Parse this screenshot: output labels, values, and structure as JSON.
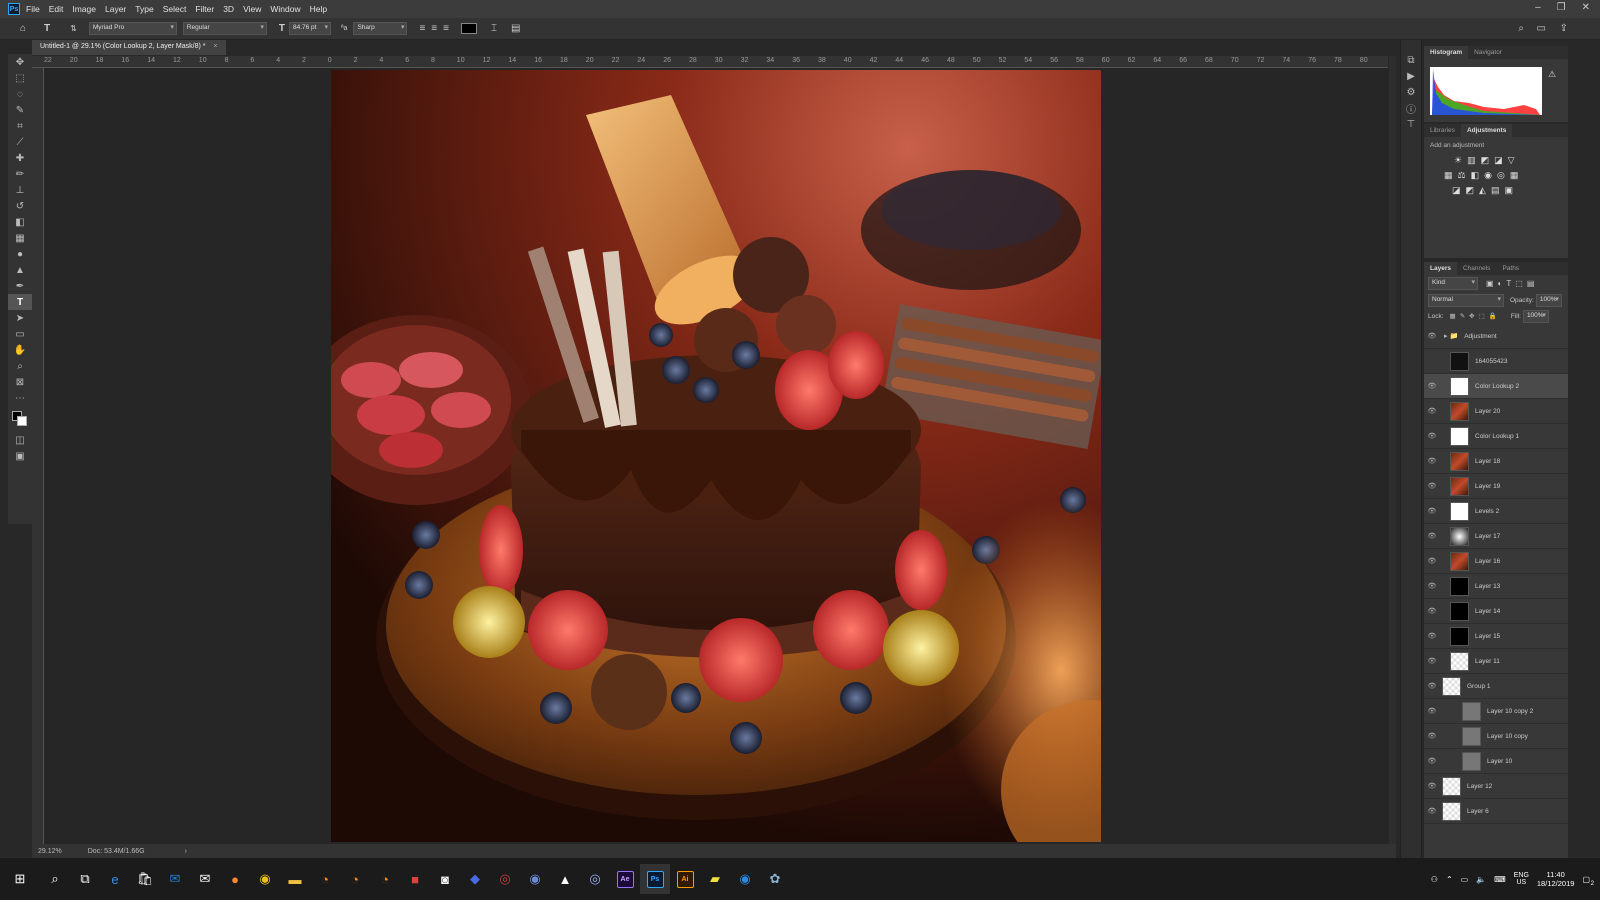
{
  "app": {
    "logo": "Ps"
  },
  "menu": [
    "File",
    "Edit",
    "Image",
    "Layer",
    "Type",
    "Select",
    "Filter",
    "3D",
    "View",
    "Window",
    "Help"
  ],
  "options": {
    "font_family": "Myriad Pro",
    "font_style": "Regular",
    "font_size": "84.76 pt",
    "antialias": "Sharp",
    "text_color": "#000000"
  },
  "document": {
    "tab_title": "Untitled-1 @ 29.1% (Color Lookup 2, Layer Mask/8) *",
    "zoom": "29.12%",
    "doc_info": "Doc: 53.4M/1.66G"
  },
  "ruler": {
    "top_ticks": [
      "22",
      "20",
      "18",
      "16",
      "14",
      "12",
      "10",
      "8",
      "6",
      "4",
      "2",
      "0",
      "2",
      "4",
      "6",
      "8",
      "10",
      "12",
      "14",
      "16",
      "18",
      "20",
      "22",
      "24",
      "26",
      "28",
      "30",
      "32",
      "34",
      "36",
      "38",
      "40",
      "42",
      "44",
      "46",
      "48",
      "50",
      "52",
      "54",
      "56",
      "58",
      "60",
      "62",
      "64",
      "66",
      "68",
      "70",
      "72",
      "74",
      "76",
      "78",
      "80"
    ]
  },
  "panels": {
    "histogram_tabs": [
      "Histogram",
      "Navigator"
    ],
    "adjust_tabs": [
      "Libraries",
      "Adjustments"
    ],
    "adjust_hint": "Add an adjustment",
    "layers_tabs": [
      "Layers",
      "Channels",
      "Paths"
    ],
    "filter_kind": "Kind",
    "blend_mode": "Normal",
    "opacity_label": "Opacity:",
    "opacity_value": "100%",
    "lock_label": "Lock:",
    "fill_label": "Fill:",
    "fill_value": "100%"
  },
  "layers": [
    {
      "name": "Adjustment",
      "thumb": "folder",
      "visible": true
    },
    {
      "name": "164055423",
      "thumb": "dark",
      "visible": false
    },
    {
      "name": "Color Lookup 2",
      "thumb": "white",
      "visible": true,
      "selected": true
    },
    {
      "name": "Layer 20",
      "thumb": "photo",
      "visible": true
    },
    {
      "name": "Color Lookup 1",
      "thumb": "white",
      "visible": true
    },
    {
      "name": "Layer 18",
      "thumb": "photo",
      "visible": true
    },
    {
      "name": "Layer 19",
      "thumb": "photo",
      "visible": true
    },
    {
      "name": "Levels 2",
      "thumb": "white",
      "visible": true
    },
    {
      "name": "Layer 17",
      "thumb": "radial",
      "visible": true
    },
    {
      "name": "Layer 16",
      "thumb": "photo",
      "visible": true
    },
    {
      "name": "Layer 13",
      "thumb": "black",
      "visible": true
    },
    {
      "name": "Layer 14",
      "thumb": "black",
      "visible": true
    },
    {
      "name": "Layer 15",
      "thumb": "black",
      "visible": true
    },
    {
      "name": "Layer 11",
      "thumb": "trans",
      "visible": true
    },
    {
      "name": "Group 1",
      "thumb": "trans",
      "visible": true
    },
    {
      "name": "Layer 10 copy 2",
      "thumb": "gray",
      "visible": true
    },
    {
      "name": "Layer 10 copy",
      "thumb": "gray",
      "visible": true
    },
    {
      "name": "Layer 10",
      "thumb": "gray",
      "visible": true
    },
    {
      "name": "Layer 12",
      "thumb": "trans",
      "visible": true
    },
    {
      "name": "Layer 6",
      "thumb": "trans",
      "visible": true
    }
  ],
  "taskbar": {
    "apps": [
      "Ae",
      "Ps",
      "Ai"
    ],
    "lang": "ENG",
    "region": "US",
    "time": "11:40",
    "date": "18/12/2019",
    "notif": "2"
  }
}
